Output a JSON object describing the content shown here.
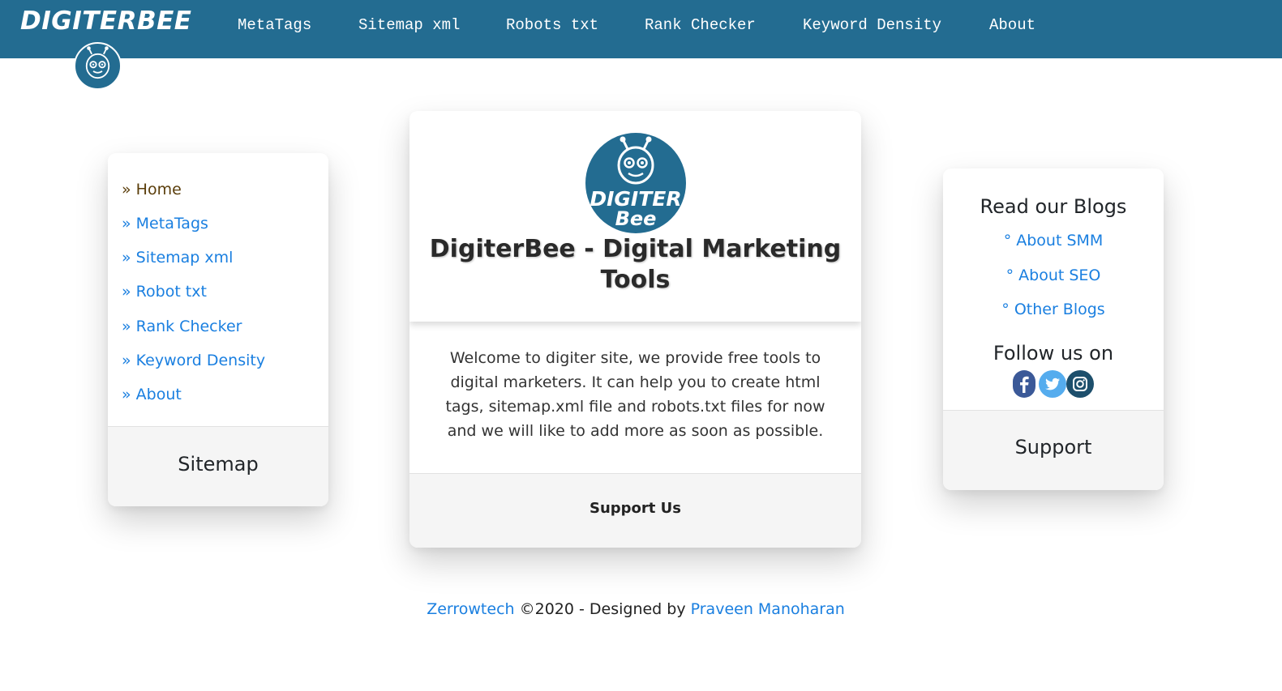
{
  "navbar": {
    "brand": "DIGITERBEE",
    "links": [
      "MetaTags",
      "Sitemap xml",
      "Robots txt",
      "Rank Checker",
      "Keyword Density",
      "About"
    ]
  },
  "sidebar": {
    "items": [
      "» Home",
      "» MetaTags",
      "» Sitemap xml",
      "» Robot txt",
      "» Rank Checker",
      "» Keyword Density",
      "» About"
    ],
    "footer_title": "Sitemap"
  },
  "main": {
    "logo_text_1": "DIGITER",
    "logo_text_2": "Bee",
    "title": "DigiterBee - Digital Marketing Tools",
    "body": "Welcome to digiter site, we provide free tools to digital marketers. It can help you to create html tags, sitemap.xml file and robots.txt files for now and we will like to add more as soon as possible.",
    "footer_label": "Support Us"
  },
  "right": {
    "blogs_heading": "Read our Blogs",
    "blog_links": [
      "° About SMM",
      "° About SEO",
      "° Other Blogs"
    ],
    "follow_heading": "Follow us on",
    "social_icons": [
      "facebook-icon",
      "twitter-icon",
      "instagram-icon"
    ],
    "footer_title": "Support"
  },
  "footer": {
    "company": "Zerrowtech",
    "middle": " ©2020 - Designed by ",
    "designer": "Praveen Manoharan"
  },
  "colors": {
    "navbar": "#236c91",
    "link": "#1a7fe0",
    "active_link": "#5a3d0a"
  }
}
